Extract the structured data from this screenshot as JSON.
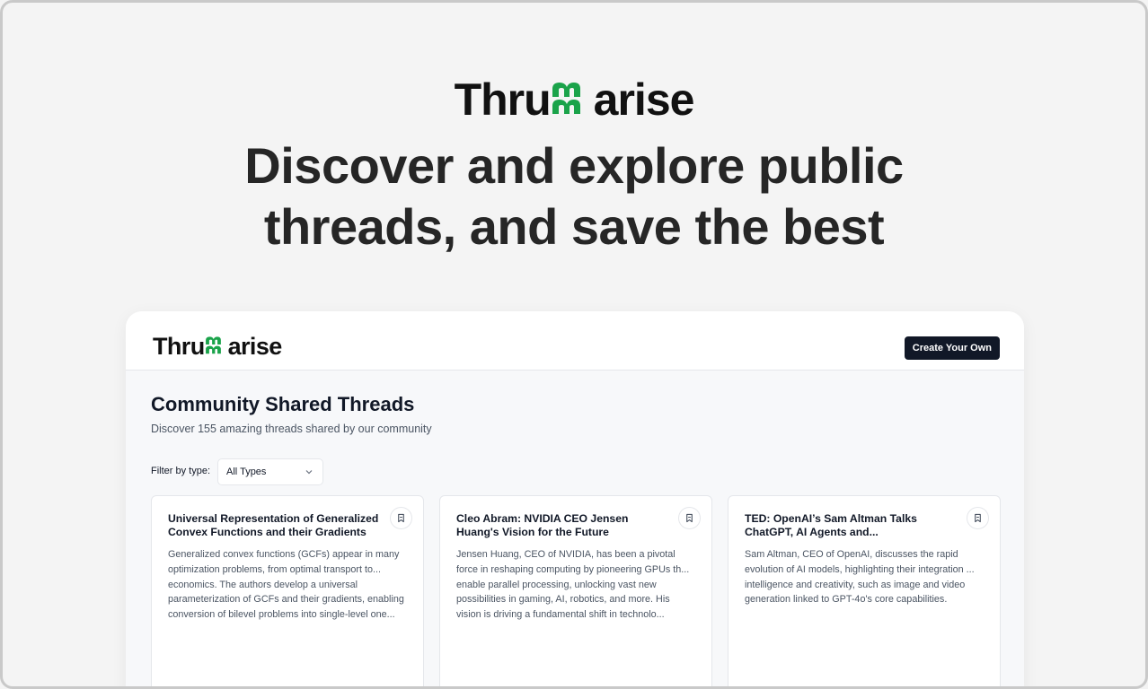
{
  "hero": {
    "logo_text_a": "Thru",
    "logo_text_b": "arise",
    "title_line1": "Discover and explore public",
    "title_line2": "threads, and save the best"
  },
  "brand": {
    "accent": "#1aa34a",
    "dark": "#111111"
  },
  "header": {
    "logo_text_a": "Thru",
    "logo_text_b": "arise",
    "create_button": "Create Your Own"
  },
  "main": {
    "title": "Community Shared Threads",
    "subtitle": "Discover 155 amazing threads shared by our community",
    "filter_label": "Filter by type:",
    "filter_value": "All Types"
  },
  "cards": [
    {
      "title": "Universal Representation of Generalized Convex Functions and their Gradients",
      "summary": "Generalized convex functions (GCFs) appear in many optimization problems, from optimal transport to... economics. The authors develop a universal parameterization of GCFs and their gradients, enabling conversion of bilevel problems into single-level one..."
    },
    {
      "title": "Cleo Abram: NVIDIA CEO Jensen Huang's Vision for the Future",
      "summary": "Jensen Huang, CEO of NVIDIA, has been a pivotal force in reshaping computing by pioneering GPUs th... enable parallel processing, unlocking vast new possibilities in gaming, AI, robotics, and more. His vision is driving a fundamental shift in technolo..."
    },
    {
      "title": "TED: OpenAI’s Sam Altman Talks ChatGPT, AI Agents and...",
      "summary": "Sam Altman, CEO of OpenAI, discusses the rapid evolution of AI models, highlighting their integration ... intelligence and creativity, such as image and video generation linked to GPT-4o's core capabilities."
    }
  ]
}
